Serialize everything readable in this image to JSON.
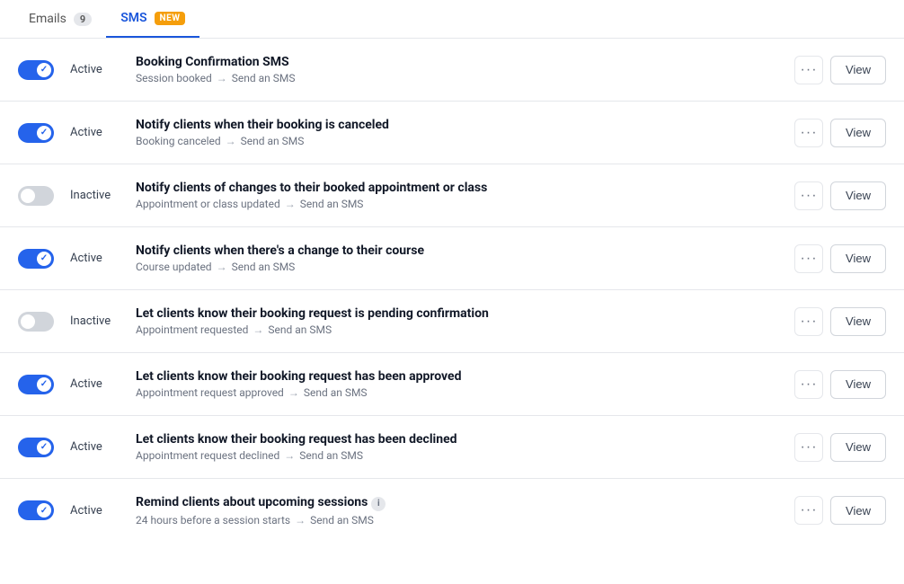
{
  "tabs": [
    {
      "id": "emails",
      "label": "Emails",
      "badge": "9",
      "active": false
    },
    {
      "id": "sms",
      "label": "SMS",
      "new_badge": "NEW",
      "active": true
    }
  ],
  "items": [
    {
      "id": 1,
      "active": true,
      "title": "Booking Confirmation SMS",
      "trigger": "Session booked",
      "action": "Send an SMS",
      "has_info": false
    },
    {
      "id": 2,
      "active": true,
      "title": "Notify clients when their booking is canceled",
      "trigger": "Booking canceled",
      "action": "Send an SMS",
      "has_info": false
    },
    {
      "id": 3,
      "active": false,
      "title": "Notify clients of changes to their booked appointment or class",
      "trigger": "Appointment or class updated",
      "action": "Send an SMS",
      "has_info": false
    },
    {
      "id": 4,
      "active": true,
      "title": "Notify clients when there's a change to their course",
      "trigger": "Course updated",
      "action": "Send an SMS",
      "has_info": false
    },
    {
      "id": 5,
      "active": false,
      "title": "Let clients know their booking request is pending confirmation",
      "trigger": "Appointment requested",
      "action": "Send an SMS",
      "has_info": false
    },
    {
      "id": 6,
      "active": true,
      "title": "Let clients know their booking request has been approved",
      "trigger": "Appointment request approved",
      "action": "Send an SMS",
      "has_info": false
    },
    {
      "id": 7,
      "active": true,
      "title": "Let clients know their booking request has been declined",
      "trigger": "Appointment request declined",
      "action": "Send an SMS",
      "has_info": false
    },
    {
      "id": 8,
      "active": true,
      "title": "Remind clients about upcoming sessions",
      "trigger": "24 hours before a session starts",
      "action": "Send an SMS",
      "has_info": true
    }
  ],
  "labels": {
    "active": "Active",
    "inactive": "Inactive",
    "arrow": "→",
    "dots": "•••",
    "view": "View",
    "info": "i"
  }
}
